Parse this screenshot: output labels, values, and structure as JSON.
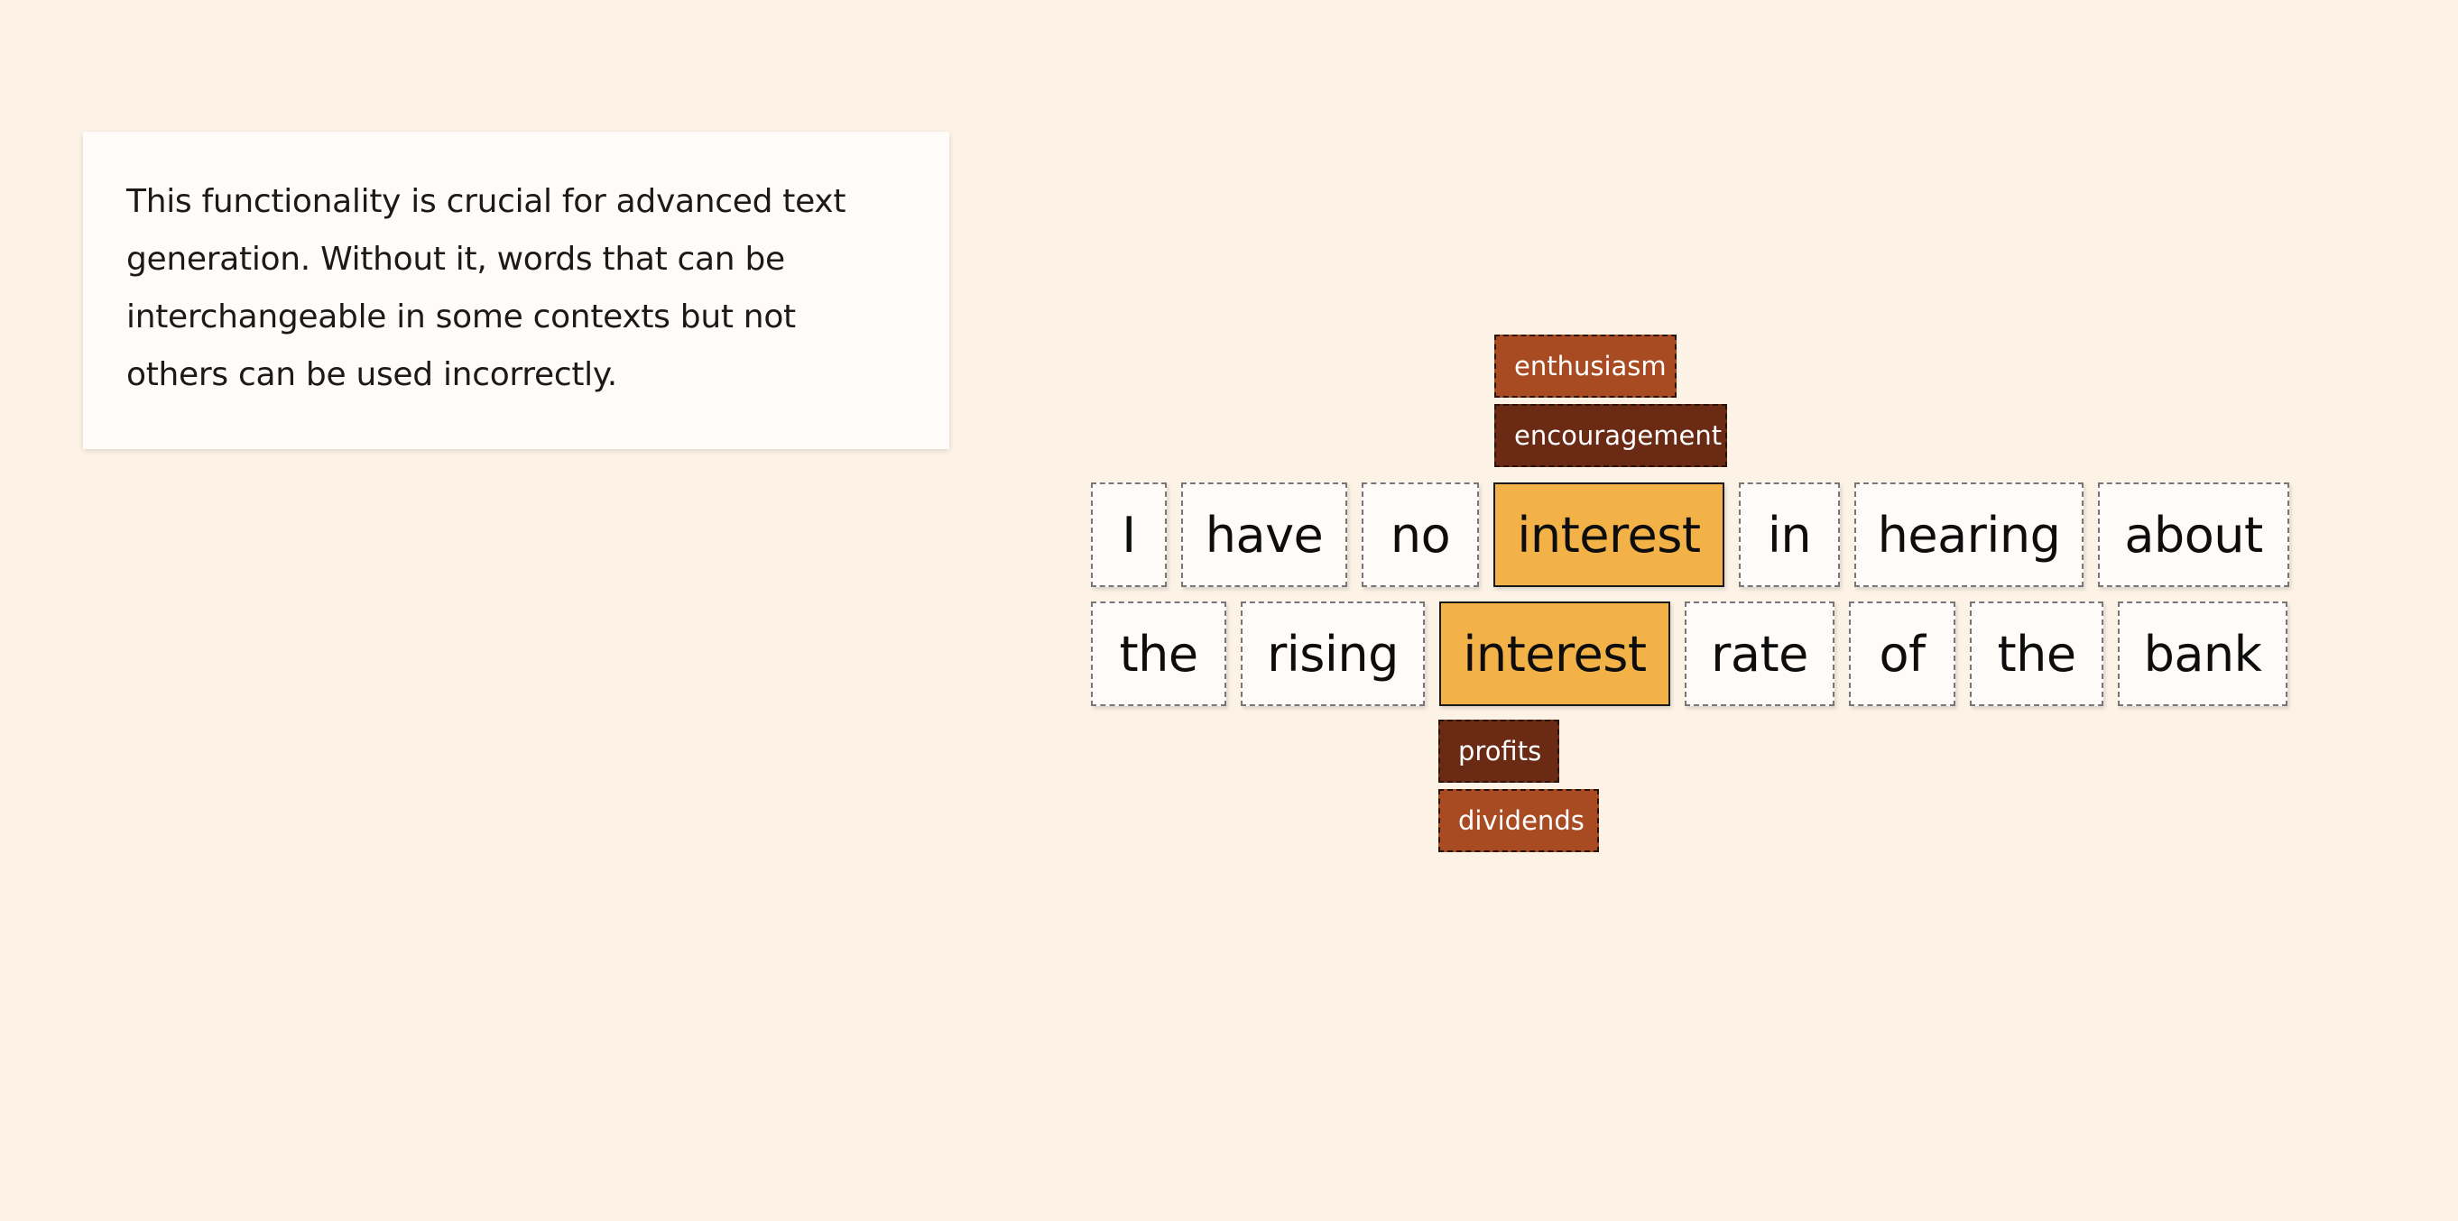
{
  "explanation": "This functionality is crucial for advanced text generation. Without it, words that can be interchangeable in some contexts but not others can be used incorrectly.",
  "sentence1": {
    "words": [
      "I",
      "have",
      "no",
      "interest",
      "in",
      "hearing",
      "about"
    ],
    "highlighted_word": "interest",
    "alternatives": [
      "enthusiasm",
      "encouragement"
    ]
  },
  "sentence2": {
    "words": [
      "the",
      "rising",
      "interest",
      "rate",
      "of",
      "the",
      "bank"
    ],
    "highlighted_word": "interest",
    "alternatives": [
      "profits",
      "dividends"
    ]
  },
  "colors": {
    "background": "#fcf2e6",
    "highlight": "#f2b247",
    "alt_rust": "#a84a22",
    "alt_brown": "#6b2a14"
  }
}
